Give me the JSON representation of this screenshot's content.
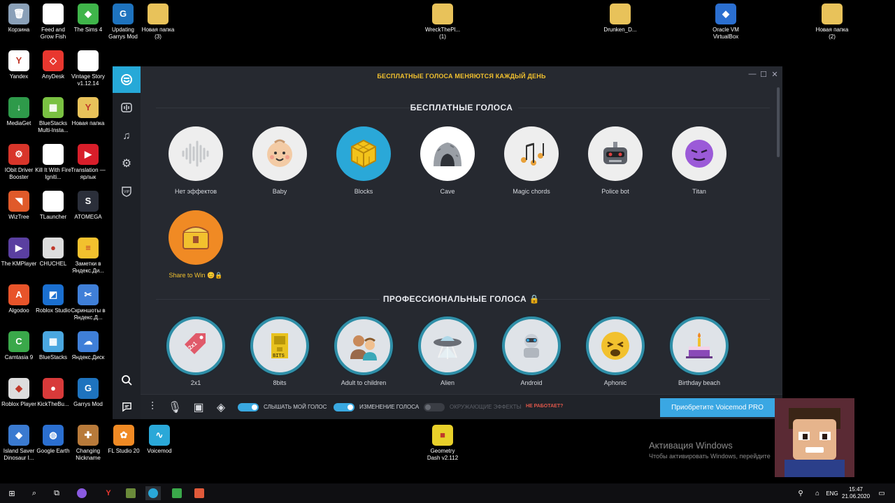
{
  "desktop": {
    "icons": [
      {
        "label": "Корзина",
        "color": "#8aa0b8",
        "glyph": "🗑"
      },
      {
        "label": "Feed and Grow Fish",
        "color": "#ffffff",
        "glyph": ""
      },
      {
        "label": "The Sims 4",
        "color": "#3fb54a",
        "glyph": "◆"
      },
      {
        "label": "Updating Garrys Mod",
        "color": "#1e73be",
        "glyph": "G"
      },
      {
        "label": "Новая папка (3)",
        "color": "#e8c25a",
        "glyph": ""
      },
      {
        "label": "Yandex",
        "color": "#ffffff",
        "glyph": "Y"
      },
      {
        "label": "AnyDesk",
        "color": "#e8372f",
        "glyph": "◇"
      },
      {
        "label": "Vintage Story v1.12.14",
        "color": "#ffffff",
        "glyph": ""
      },
      {
        "label": "MediaGet",
        "color": "#2e9a4a",
        "glyph": "↓"
      },
      {
        "label": "BlueStacks Multi-Insta...",
        "color": "#7ac142",
        "glyph": "▦"
      },
      {
        "label": "Новая папка",
        "color": "#e8c25a",
        "glyph": "Y"
      },
      {
        "label": "IObit Driver Booster",
        "color": "#d8352a",
        "glyph": "⚙"
      },
      {
        "label": "Kill It With Fire Igniti...",
        "color": "#ffffff",
        "glyph": ""
      },
      {
        "label": "Translation — ярлык",
        "color": "#d81e2a",
        "glyph": "▶"
      },
      {
        "label": "WizTree",
        "color": "#e05a2a",
        "glyph": "◥"
      },
      {
        "label": "TLauncher",
        "color": "#ffffff",
        "glyph": ""
      },
      {
        "label": "ATOMEGA",
        "color": "#2b2f3a",
        "glyph": "S"
      },
      {
        "label": "The KMPlayer",
        "color": "#5a3fa0",
        "glyph": "▶"
      },
      {
        "label": "CHUCHEL",
        "color": "#ddd",
        "glyph": "●"
      },
      {
        "label": "Заметки в Яндекс.Ди...",
        "color": "#f2c12e",
        "glyph": "≡"
      },
      {
        "label": "Algodoo",
        "color": "#e8542a",
        "glyph": "A"
      },
      {
        "label": "Roblox Studio",
        "color": "#1a6fd0",
        "glyph": "◩"
      },
      {
        "label": "Скриншоты в Яндекс.Д...",
        "color": "#3f7fd8",
        "glyph": "✂"
      },
      {
        "label": "Camtasia 9",
        "color": "#3aa84a",
        "glyph": "C"
      },
      {
        "label": "BlueStacks",
        "color": "#4aa7e0",
        "glyph": "▦"
      },
      {
        "label": "Яндекс.Диск",
        "color": "#3f7fd8",
        "glyph": "☁"
      },
      {
        "label": "Roblox Player",
        "color": "#dddddd",
        "glyph": "◆"
      },
      {
        "label": "KickTheBu...",
        "color": "#d83a3a",
        "glyph": "●"
      },
      {
        "label": "Garrys Mod",
        "color": "#1e73be",
        "glyph": "G"
      },
      {
        "label": "Island Saver Dinosaur I...",
        "color": "#3a7ad0",
        "glyph": "◆"
      },
      {
        "label": "Google Earth",
        "color": "#2b6fd0",
        "glyph": "◍"
      },
      {
        "label": "Changing Nickname",
        "color": "#b87a3a",
        "glyph": "✚"
      },
      {
        "label": "FL Studio 20",
        "color": "#f08a24",
        "glyph": "✿"
      },
      {
        "label": "Voicemod",
        "color": "#2aa8d8",
        "glyph": "∿"
      },
      {
        "label": "WreckThePl... (1)",
        "color": "#e8c25a",
        "glyph": ""
      },
      {
        "label": "Drunken_D...",
        "color": "#e8c25a",
        "glyph": ""
      },
      {
        "label": "Oracle VM VirtualBox",
        "color": "#2b6fd0",
        "glyph": "◆"
      },
      {
        "label": "Новая папка (2)",
        "color": "#e8c25a",
        "glyph": ""
      },
      {
        "label": "Geometry Dash v2.112",
        "color": "#e8d02a",
        "glyph": "■"
      }
    ]
  },
  "app": {
    "banner": "БЕСПЛАТНЫЕ ГОЛОСА МЕНЯЮТСЯ КАЖДЫЙ ДЕНЬ",
    "free_title": "БЕСПЛАТНЫЕ ГОЛОСА",
    "pro_title": "ПРОФЕССИОНАЛЬНЫЕ ГОЛОСА",
    "free_voices": [
      {
        "name": "Нет эффектов",
        "icon": "waveform-icon",
        "bg": "#eeeeee"
      },
      {
        "name": "Baby",
        "icon": "baby-icon",
        "bg": "#eeeeee"
      },
      {
        "name": "Blocks",
        "icon": "blocks-icon",
        "bg": "#2aa8d8"
      },
      {
        "name": "Cave",
        "icon": "cave-icon",
        "bg": "#ffffff"
      },
      {
        "name": "Magic chords",
        "icon": "music-notes-icon",
        "bg": "#eeeeee"
      },
      {
        "name": "Police bot",
        "icon": "robot-icon",
        "bg": "#eeeeee"
      },
      {
        "name": "Titan",
        "icon": "titan-face-icon",
        "bg": "#eeeeee"
      },
      {
        "name": "Share to Win 😊🔒",
        "icon": "treasure-chest-icon",
        "bg": "#f08a24"
      }
    ],
    "pro_voices": [
      {
        "name": "2x1",
        "icon": "price-tag-icon"
      },
      {
        "name": "8bits",
        "icon": "8bit-icon"
      },
      {
        "name": "Adult to children",
        "icon": "adult-child-icon"
      },
      {
        "name": "Alien",
        "icon": "ufo-icon"
      },
      {
        "name": "Android",
        "icon": "android-icon"
      },
      {
        "name": "Aphonic",
        "icon": "sad-face-icon"
      },
      {
        "name": "Birthday beach",
        "icon": "cake-icon"
      }
    ],
    "bottom": {
      "hear_my_voice": "СЛЫШАТЬ МОЙ ГОЛОС",
      "voice_changer": "ИЗМЕНЕНИЕ ГОЛОСА",
      "ambient": "ОКРУЖАЮЩИЕ ЭФФЕКТЫ",
      "not_working": "НЕ РАБОТАЕТ?",
      "pro_button": "Приобретите Voicemod PRO"
    },
    "colors": {
      "accent": "#26a9d8",
      "banner": "#f2c12e",
      "pro_ring": "#2f8fa8"
    }
  },
  "activation": {
    "title": "Активация Windows",
    "subtitle": "Чтобы активировать Windows, перейдите"
  },
  "taskbar": {
    "lang": "ENG",
    "time": "15:47",
    "date": "21.06.2020"
  }
}
